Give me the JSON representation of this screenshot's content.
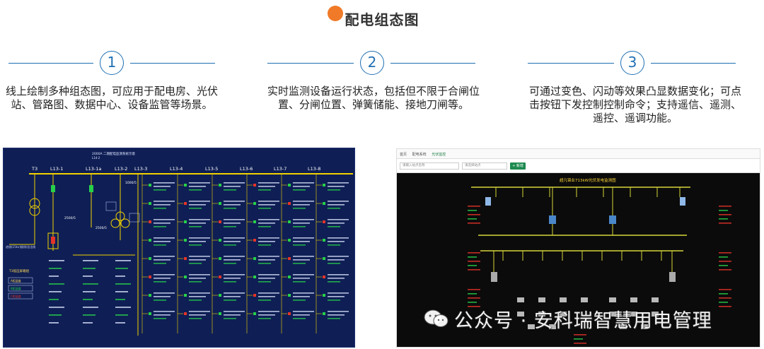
{
  "page_title": "配电组态图",
  "steps": [
    {
      "number": "1",
      "text": "线上绘制多种组态图，可应用于配电房、光伏站、管路图、数据中心、设备监管等场景。"
    },
    {
      "number": "2",
      "text": "实时监测设备运行状态，包括但不限于合闸位 置、分闸位置、弹簧储能、接地刀闸等。"
    },
    {
      "number": "3",
      "text": "可通过变色、闪动等效果凸显数据变化；可点击按钮下发控制控制命令；支持遥信、遥测、遥控、遥调功能。"
    }
  ],
  "left_screenshot": {
    "header": "2000A 二期配电监测系统示意",
    "subheader": "L14-2",
    "feeders": [
      "T3",
      "L13-1",
      "L13-1a",
      "L13-2",
      "L13-3",
      "L13-4",
      "L13-5",
      "L13-6",
      "L13-7",
      "L13-8"
    ],
    "label_2500a": "2500/5",
    "label_1000": "1000/5",
    "inlet_label": "进线(15kv)接线/总出线",
    "legend_title": "T3低压屏箱组",
    "legend_items": [
      "A相温度",
      "B相温度",
      "C相温度"
    ],
    "accent_yellow": "#f2d200",
    "accent_green": "#27d04a",
    "accent_red": "#e6332a"
  },
  "right_screenshot": {
    "tabs": [
      "首页",
      "配电系统",
      "光伏监控"
    ],
    "search_placeholder": "请输入站点名称",
    "select_placeholder": "请选择站点",
    "add_button": "+ 新增",
    "diagram_title": "超凡锦业713kW光伏发电监测图",
    "accent_green": "#1c8a4f"
  },
  "watermark": "公众号 · 安科瑞智慧用电管理",
  "colors": {
    "title_dot": "#f07a28",
    "step_blue": "#1e6fb3"
  }
}
